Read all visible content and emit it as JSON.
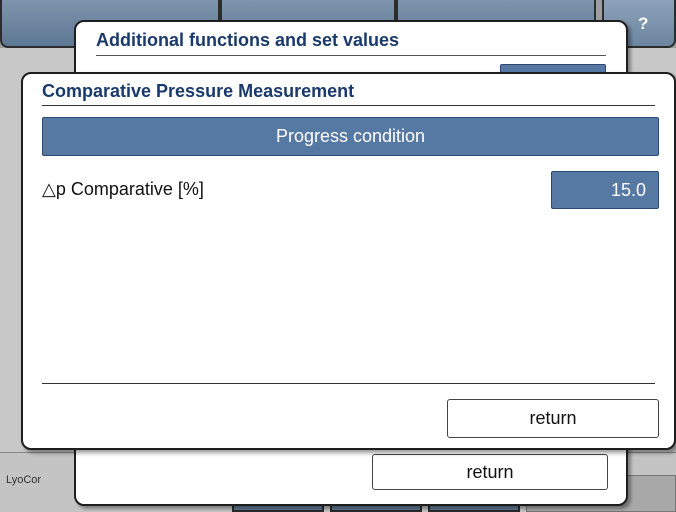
{
  "help": {
    "label": "?"
  },
  "footer": {
    "status_text": "LyoCor"
  },
  "dialog_background": {
    "title": "Additional functions and set values",
    "return_label": "return"
  },
  "dialog_foreground": {
    "title": "Comparative Pressure Measurement",
    "section": "Progress condition",
    "parameter": {
      "label": "△p Comparative [%]",
      "value": "15.0"
    },
    "return_label": "return"
  },
  "colors": {
    "accent_blue": "#5679a3",
    "title_navy": "#1a3a6b",
    "tab_blue": "#6b849f"
  }
}
